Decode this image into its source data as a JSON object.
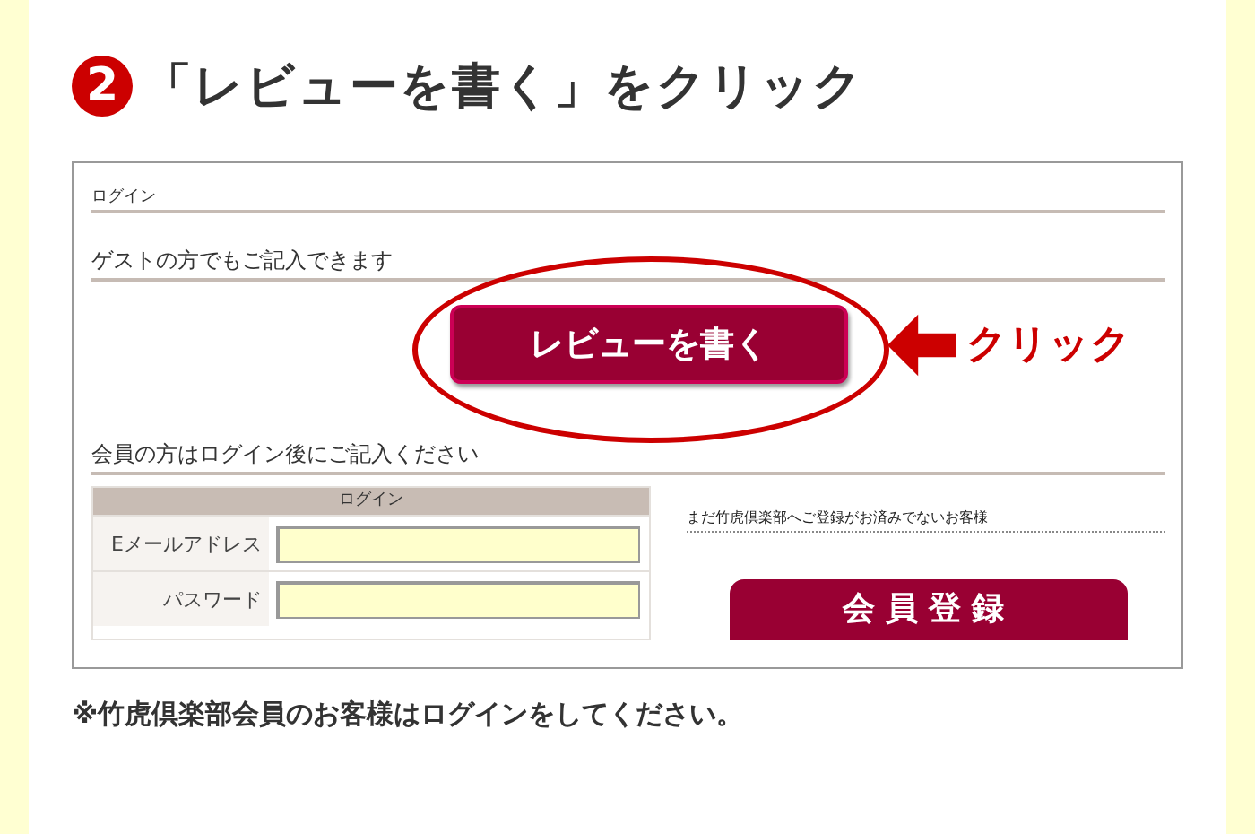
{
  "step": {
    "number": "2",
    "title": "「レビューを書く」をクリック"
  },
  "screen": {
    "section_title": "ログイン",
    "guest_heading": "ゲストの方でもご記入できます",
    "review_button": "レビューを書く",
    "member_heading": "会員の方はログイン後にご記入ください",
    "login_table": {
      "header": "ログイン",
      "fields": [
        {
          "label": "Eメールアドレス"
        },
        {
          "label": "パスワード"
        }
      ]
    },
    "register_note": "まだ竹虎倶楽部へご登録がお済みでないお客様",
    "register_button": "会員登録"
  },
  "callout": {
    "label": "クリック"
  },
  "note": "※竹虎倶楽部会員のお客様はログインをしてください。"
}
